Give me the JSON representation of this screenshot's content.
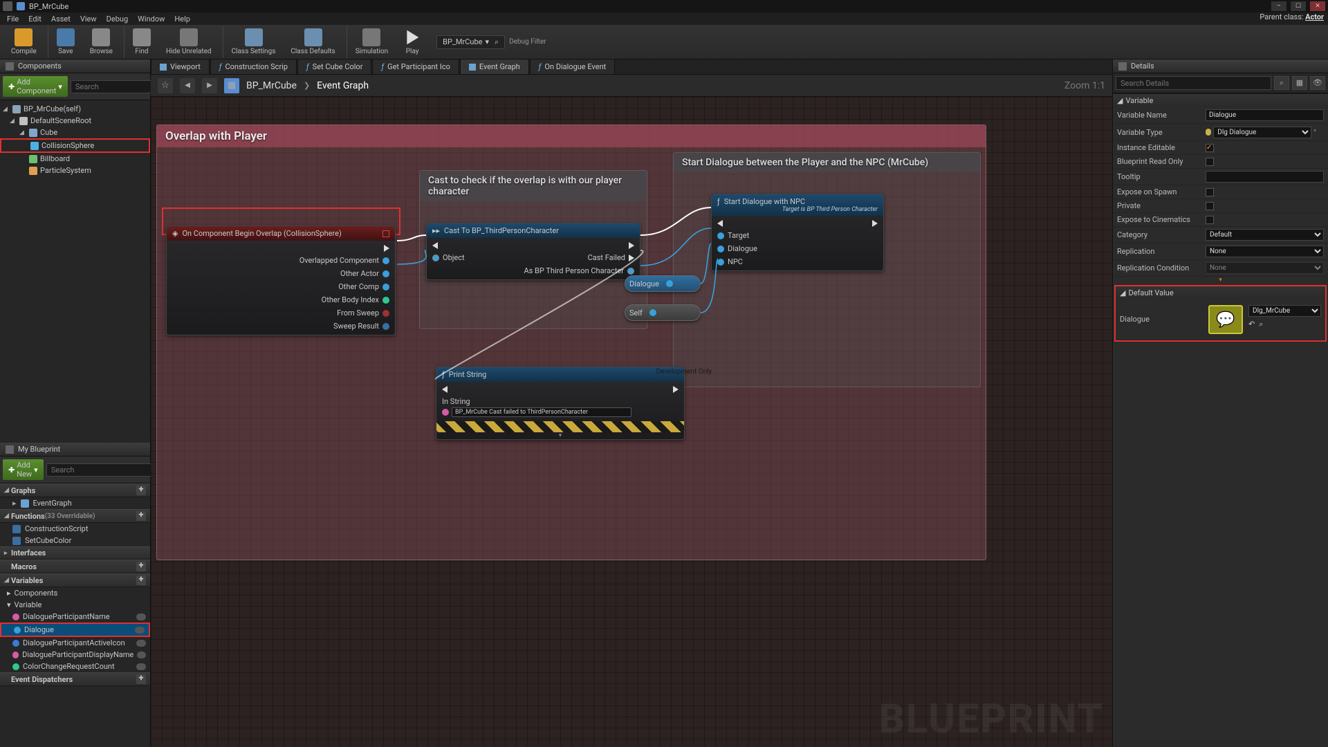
{
  "window_title": "BP_MrCube",
  "parent_class_label": "Parent class:",
  "parent_class_value": "Actor",
  "menubar": [
    "File",
    "Edit",
    "Asset",
    "View",
    "Debug",
    "Window",
    "Help"
  ],
  "toolbar": {
    "compile": "Compile",
    "save": "Save",
    "browse": "Browse",
    "find": "Find",
    "hide": "Hide Unrelated",
    "settings": "Class Settings",
    "defaults": "Class Defaults",
    "simulate": "Simulation",
    "play": "Play",
    "debugtarget": "BP_MrCube",
    "debugfilter": "Debug Filter"
  },
  "components": {
    "title": "Components",
    "add": "Add Component",
    "search_ph": "Search",
    "items": [
      {
        "label": "BP_MrCube(self)",
        "icon": "#8aa3b8",
        "lvl": 0
      },
      {
        "label": "DefaultSceneRoot",
        "icon": "#c0c0c0",
        "lvl": 1
      },
      {
        "label": "Cube",
        "icon": "#80a8cc",
        "lvl": 2
      },
      {
        "label": "CollisionSphere",
        "icon": "#4db0e6",
        "lvl": 3,
        "red": true
      },
      {
        "label": "Billboard",
        "icon": "#6fbf6f",
        "lvl": 3
      },
      {
        "label": "ParticleSystem",
        "icon": "#e0a050",
        "lvl": 3
      }
    ]
  },
  "myblueprint": {
    "title": "My Blueprint",
    "add": "Add New",
    "search_ph": "Search",
    "graphs": "Graphs",
    "eventgraph": "EventGraph",
    "functions": "Functions",
    "functions_note": "(33 Overridable)",
    "fn_items": [
      "ConstructionScript",
      "SetCubeColor"
    ],
    "interfaces": "Interfaces",
    "macros": "Macros",
    "variables": "Variables",
    "var_cat_components": "Components",
    "var_cat_variable": "Variable",
    "vars": [
      {
        "name": "DialogueParticipantName",
        "color": "#d85aa6"
      },
      {
        "name": "Dialogue",
        "color": "#3aa0da",
        "selected": true,
        "red": true
      },
      {
        "name": "DialogueParticipantActiveIcon",
        "color": "#3a7ad8"
      },
      {
        "name": "DialogueParticipantDisplayName",
        "color": "#d85aa6"
      },
      {
        "name": "ColorChangeRequestCount",
        "color": "#2fc98f"
      }
    ],
    "dispatch": "Event Dispatchers"
  },
  "tabs": [
    {
      "label": "Viewport",
      "icon": "#6aa3d0"
    },
    {
      "label": "Construction Scrip",
      "icon": "#5a8dd0",
      "fn": true
    },
    {
      "label": "Set Cube Color",
      "icon": "#5a8dd0",
      "fn": true
    },
    {
      "label": "Get Participant Ico",
      "icon": "#5a8dd0",
      "fn": true
    },
    {
      "label": "Event Graph",
      "icon": "#6aa3d0",
      "active": true
    },
    {
      "label": "On Dialogue Event",
      "icon": "#5a8dd0",
      "fn": true
    }
  ],
  "breadcrumb": {
    "root": "BP_MrCube",
    "leaf": "Event Graph",
    "zoom": "Zoom 1:1"
  },
  "graph": {
    "watermark": "BLUEPRINT",
    "overlap_title": "Overlap with Player",
    "cast_comment": "Cast to check if the overlap is with our player character",
    "dlg_comment": "Start Dialogue between the Player and the NPC (MrCube)",
    "event_node": {
      "title": "On Component Begin Overlap (CollisionSphere)",
      "outs": [
        "Overlapped Component",
        "Other Actor",
        "Other Comp",
        "Other Body Index",
        "From Sweep",
        "Sweep Result"
      ]
    },
    "cast_node": {
      "title": "Cast To BP_ThirdPersonCharacter",
      "in": "Object",
      "out_exec": "",
      "out_fail": "Cast Failed",
      "out_as": "As BP Third Person Character"
    },
    "start_node": {
      "title": "Start Dialogue with NPC",
      "subtitle": "Target is BP Third Person Character",
      "ins": [
        "Target",
        "Dialogue",
        "NPC"
      ]
    },
    "pill_dialogue": "Dialogue",
    "pill_self": "Self",
    "print_node": {
      "title": "Print String",
      "in_label": "In String",
      "in_value": "BP_MrCube Cast failed to ThirdPersonCharacter",
      "dev": "Development Only"
    }
  },
  "details": {
    "title": "Details",
    "search_ph": "Search Details",
    "sec_variable": "Variable",
    "rows": {
      "name_l": "Variable Name",
      "name_v": "Dialogue",
      "type_l": "Variable Type",
      "type_v": "Dlg Dialogue",
      "inst_l": "Instance Editable",
      "bro_l": "Blueprint Read Only",
      "tip_l": "Tooltip",
      "spawn_l": "Expose on Spawn",
      "priv_l": "Private",
      "cine_l": "Expose to Cinematics",
      "cat_l": "Category",
      "cat_v": "Default",
      "rep_l": "Replication",
      "rep_v": "None",
      "repc_l": "Replication Condition",
      "repc_v": "None"
    },
    "sec_default": "Default Value",
    "dlg_l": "Dialogue",
    "dlg_asset": "Dlg_MrCube"
  }
}
